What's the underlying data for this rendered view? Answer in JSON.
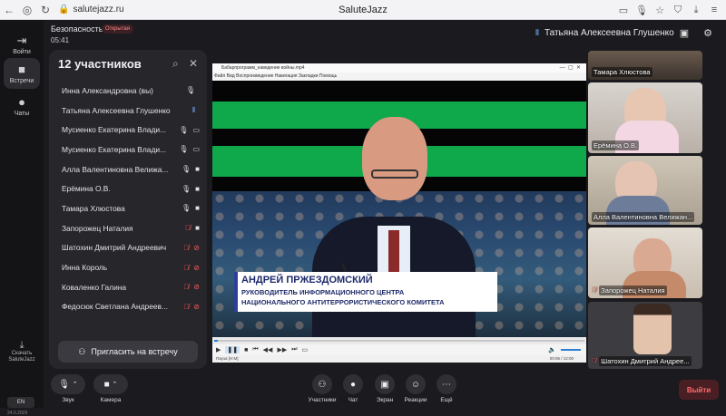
{
  "browser": {
    "url": "salutejazz.ru",
    "tab_title": "SaluteJazz",
    "icons": [
      "back-icon",
      "home-icon",
      "refresh-icon",
      "lock-icon",
      "star-icon",
      "menu-icon"
    ]
  },
  "rail": {
    "items": [
      {
        "label": "Войти",
        "icon": "login-icon"
      },
      {
        "label": "Встречи",
        "icon": "camera-icon"
      },
      {
        "label": "Чаты",
        "icon": "chat-icon"
      }
    ],
    "download_label": "Скачать SaluteJazz",
    "language": "EN",
    "version": "24.6.2029"
  },
  "header": {
    "meeting_title": "Безопасность",
    "badge": "Открытая",
    "timer": "05:41",
    "active_speaker": "Татьяна Алексеевна Глушенко"
  },
  "panel": {
    "title": "12 участников",
    "participants": [
      {
        "name": "Инна Александровна (вы)",
        "mic": "on",
        "screen": false,
        "cam": "none"
      },
      {
        "name": "Татьяна Алексеевна Глушенко",
        "mic": "speaking",
        "screen": false,
        "cam": "none"
      },
      {
        "name": "Мусиенко Екатерина Влади...",
        "mic": "on",
        "screen": true,
        "cam": "none"
      },
      {
        "name": "Мусиенко Екатерина Влади...",
        "mic": "on",
        "screen": true,
        "cam": "none"
      },
      {
        "name": "Алла Валентиновна Велижа...",
        "mic": "on",
        "screen": false,
        "cam": "on"
      },
      {
        "name": "Ерёмина О.В.",
        "mic": "on",
        "screen": false,
        "cam": "on"
      },
      {
        "name": "Тамара Хлюстова",
        "mic": "on",
        "screen": false,
        "cam": "on"
      },
      {
        "name": "Запорожец Наталия",
        "mic": "off",
        "screen": false,
        "cam": "on"
      },
      {
        "name": "Шатохин Дмитрий Андреевич",
        "mic": "off",
        "screen": false,
        "cam": "off"
      },
      {
        "name": "Инна Король",
        "mic": "off",
        "screen": false,
        "cam": "off"
      },
      {
        "name": "Коваленко Галина",
        "mic": "off",
        "screen": false,
        "cam": "off"
      },
      {
        "name": "Федосюк Светлана Андреев...",
        "mic": "off",
        "screen": false,
        "cam": "off"
      }
    ],
    "invite_label": "Пригласить на встречу"
  },
  "player": {
    "title": "Бабарпрограмм_наведение войны.mp4",
    "menu": "Файл  Вид  Воспроизведение  Навигация  Закладки  Помощь",
    "lower_third_name": "АНДРЕЙ ПРЖЕЗДОМСКИЙ",
    "lower_third_role_1": "РУКОВОДИТЕЛЬ ИНФОРМАЦИОННОГО ЦЕНТРА",
    "lower_third_role_2": "НАЦИОНАЛЬНОГО АНТИТЕРРОРИСТИЧЕСКОГО КОМИТЕТА",
    "status_left": "Пауза [H:M]",
    "status_right": "00:06 / 12:00",
    "progress": 0.01
  },
  "tiles": [
    {
      "name": "Тамара Хлюстова",
      "muted": false
    },
    {
      "name": "Ерёмина О.В.",
      "muted": false
    },
    {
      "name": "Алла Валентиновна Велижан...",
      "muted": false
    },
    {
      "name": "Запорожец Наталия",
      "muted": true
    },
    {
      "name": "Шатохин Дмитрий Андрее...",
      "muted": true
    }
  ],
  "toolbar": {
    "sound": "Звук",
    "camera": "Камера",
    "participants": "Участники",
    "chat": "Чат",
    "screen": "Экран",
    "reactions": "Реакции",
    "more": "Ещё",
    "leave": "Выйти"
  },
  "colors": {
    "background": "#1b1b1f",
    "panel": "#26262b",
    "muted_red": "#ff5a5a",
    "stripe_green": "#0fa84a"
  }
}
